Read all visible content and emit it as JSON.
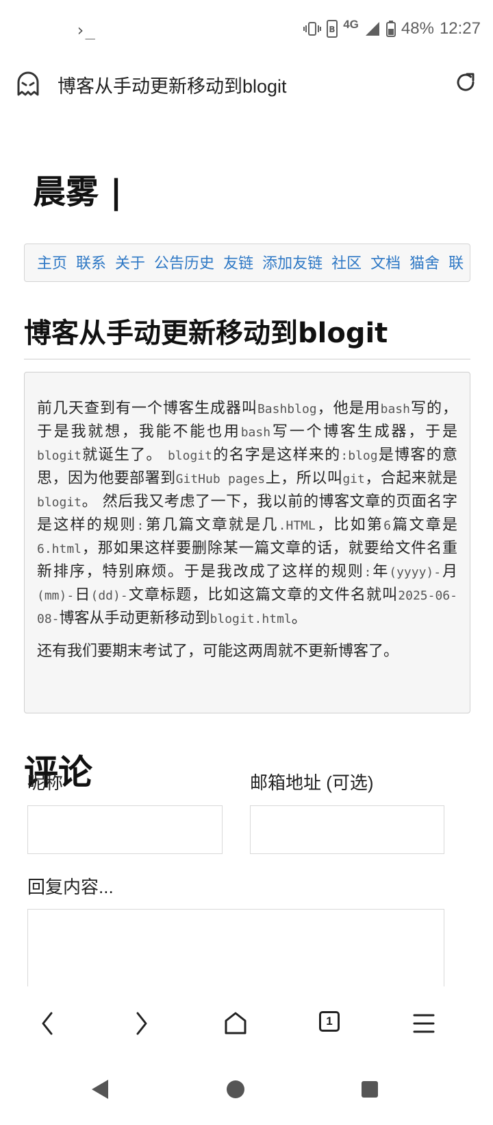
{
  "status_bar": {
    "terminal_glyph": "›_",
    "network": "4G",
    "battery": "48%",
    "time": "12:27"
  },
  "toolbar": {
    "page_title": "博客从手动更新移动到blogit"
  },
  "site": {
    "title": "晨雾 |"
  },
  "nav": {
    "items": [
      "主页",
      "联系",
      "关于",
      "公告历史",
      "友链",
      "添加友链",
      "社区",
      "文档",
      "猫舍",
      "联"
    ]
  },
  "post": {
    "title": "博客从手动更新移动到blogit",
    "paragraph1": [
      {
        "t": "前几天查到有一个博客生成器叫"
      },
      {
        "t": "Bashblog",
        "m": true
      },
      {
        "t": "，他是用"
      },
      {
        "t": "bash",
        "m": true
      },
      {
        "t": "写的，于是我就想，我能不能也用"
      },
      {
        "t": "bash",
        "m": true
      },
      {
        "t": "写一个博客生成器，于是"
      },
      {
        "t": "blogit",
        "m": true
      },
      {
        "t": "就诞生了。 "
      },
      {
        "t": "blogit",
        "m": true
      },
      {
        "t": "的名字是这样来的"
      },
      {
        "t": ":blog",
        "m": true
      },
      {
        "t": "是博客的意思，因为他要部署到"
      },
      {
        "t": "GitHub pages",
        "m": true
      },
      {
        "t": "上，所以叫"
      },
      {
        "t": "git",
        "m": true
      },
      {
        "t": "，合起来就是"
      },
      {
        "t": "blogit",
        "m": true
      },
      {
        "t": "。 然后我又考虑了一下，我以前的博客文章的页面名字是这样的规则"
      },
      {
        "t": ":",
        "m": true
      },
      {
        "t": "第几篇文章就是几"
      },
      {
        "t": ".HTML",
        "m": true
      },
      {
        "t": "，比如第"
      },
      {
        "t": "6",
        "m": true
      },
      {
        "t": "篇文章是"
      },
      {
        "t": "6.html",
        "m": true
      },
      {
        "t": "，那如果这样要删除某一篇文章的话，就要给文件名重新排序，特别麻烦。于是我改成了这样的规则"
      },
      {
        "t": ":",
        "m": true
      },
      {
        "t": "年"
      },
      {
        "t": "(yyyy)-",
        "m": true
      },
      {
        "t": "月"
      },
      {
        "t": "(mm)-",
        "m": true
      },
      {
        "t": "日"
      },
      {
        "t": "(dd)-",
        "m": true
      },
      {
        "t": "文章标题，比如这篇文章的文件名就叫"
      },
      {
        "t": "2025-06-08-",
        "m": true
      },
      {
        "t": "博客从手动更新移动到"
      },
      {
        "t": "blogit.html",
        "m": true
      },
      {
        "t": "。"
      }
    ],
    "paragraph2": "还有我们要期末考试了，可能这两周就不更新博客了。"
  },
  "comments": {
    "heading": "评论",
    "nickname_label": "昵称",
    "email_label": "邮箱地址 (可选)",
    "reply_label": "回复内容..."
  },
  "browser_nav": {
    "tab_count": "1"
  },
  "colors": {
    "link": "#2e78c5",
    "box_bg": "#f6f6f6",
    "border": "#cfcfcf"
  }
}
